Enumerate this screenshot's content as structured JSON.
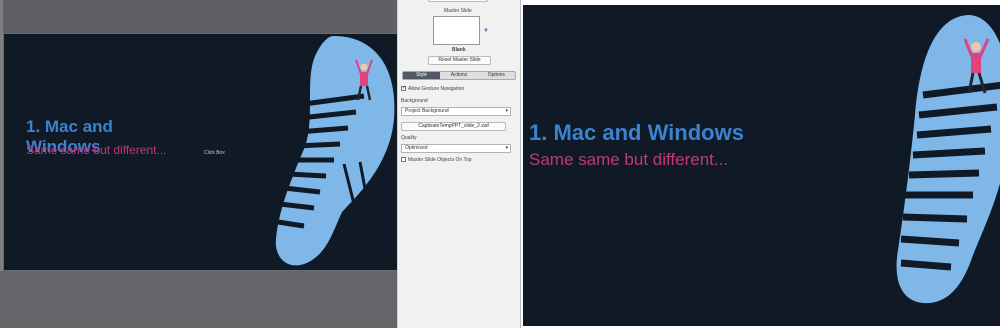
{
  "editor": {
    "slide_title": "1. Mac and Windows",
    "slide_subtitle": "Same same but different...",
    "tiny_caption": "Click Box"
  },
  "properties": {
    "master_slide_label": "Master Slide",
    "master_name": "Blank",
    "reset_button": "Reset Master Slide",
    "tabs": [
      {
        "label": "Style"
      },
      {
        "label": "Actions"
      },
      {
        "label": "Options"
      }
    ],
    "allow_gesture_label": "Allow Gesture Navigation",
    "allow_gesture_checked": true,
    "background_label": "Background",
    "background_value": "Project Background",
    "swf_file": "CaptivateTempPPT_slide_2.swf",
    "quality_label": "Quality",
    "quality_value": "Optimized",
    "master_on_top_label": "Master Slide Objects On Top",
    "master_on_top_checked": false
  },
  "preview": {
    "slide_title": "1. Mac and Windows",
    "slide_subtitle": "Same same but different..."
  },
  "colors": {
    "slide_bg": "#101a26",
    "title": "#3b82d0",
    "subtitle": "#c2367b",
    "footprint": "#7fb8e8",
    "active_tab": "#525866"
  }
}
